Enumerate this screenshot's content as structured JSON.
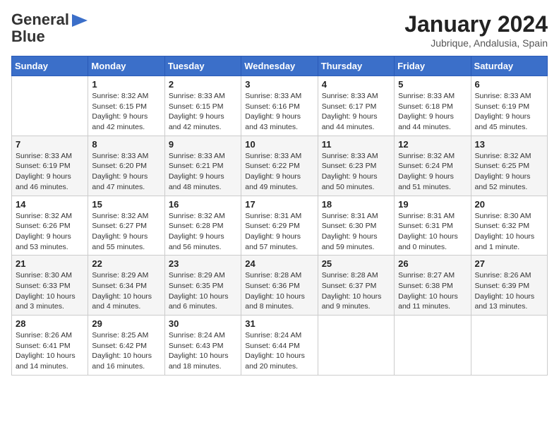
{
  "logo": {
    "general": "General",
    "blue": "Blue",
    "arrow_symbol": "▶"
  },
  "title": "January 2024",
  "location": "Jubrique, Andalusia, Spain",
  "headers": [
    "Sunday",
    "Monday",
    "Tuesday",
    "Wednesday",
    "Thursday",
    "Friday",
    "Saturday"
  ],
  "weeks": [
    [
      {
        "day": "",
        "info": ""
      },
      {
        "day": "1",
        "info": "Sunrise: 8:32 AM\nSunset: 6:15 PM\nDaylight: 9 hours\nand 42 minutes."
      },
      {
        "day": "2",
        "info": "Sunrise: 8:33 AM\nSunset: 6:15 PM\nDaylight: 9 hours\nand 42 minutes."
      },
      {
        "day": "3",
        "info": "Sunrise: 8:33 AM\nSunset: 6:16 PM\nDaylight: 9 hours\nand 43 minutes."
      },
      {
        "day": "4",
        "info": "Sunrise: 8:33 AM\nSunset: 6:17 PM\nDaylight: 9 hours\nand 44 minutes."
      },
      {
        "day": "5",
        "info": "Sunrise: 8:33 AM\nSunset: 6:18 PM\nDaylight: 9 hours\nand 44 minutes."
      },
      {
        "day": "6",
        "info": "Sunrise: 8:33 AM\nSunset: 6:19 PM\nDaylight: 9 hours\nand 45 minutes."
      }
    ],
    [
      {
        "day": "7",
        "info": "Sunrise: 8:33 AM\nSunset: 6:19 PM\nDaylight: 9 hours\nand 46 minutes."
      },
      {
        "day": "8",
        "info": "Sunrise: 8:33 AM\nSunset: 6:20 PM\nDaylight: 9 hours\nand 47 minutes."
      },
      {
        "day": "9",
        "info": "Sunrise: 8:33 AM\nSunset: 6:21 PM\nDaylight: 9 hours\nand 48 minutes."
      },
      {
        "day": "10",
        "info": "Sunrise: 8:33 AM\nSunset: 6:22 PM\nDaylight: 9 hours\nand 49 minutes."
      },
      {
        "day": "11",
        "info": "Sunrise: 8:33 AM\nSunset: 6:23 PM\nDaylight: 9 hours\nand 50 minutes."
      },
      {
        "day": "12",
        "info": "Sunrise: 8:32 AM\nSunset: 6:24 PM\nDaylight: 9 hours\nand 51 minutes."
      },
      {
        "day": "13",
        "info": "Sunrise: 8:32 AM\nSunset: 6:25 PM\nDaylight: 9 hours\nand 52 minutes."
      }
    ],
    [
      {
        "day": "14",
        "info": "Sunrise: 8:32 AM\nSunset: 6:26 PM\nDaylight: 9 hours\nand 53 minutes."
      },
      {
        "day": "15",
        "info": "Sunrise: 8:32 AM\nSunset: 6:27 PM\nDaylight: 9 hours\nand 55 minutes."
      },
      {
        "day": "16",
        "info": "Sunrise: 8:32 AM\nSunset: 6:28 PM\nDaylight: 9 hours\nand 56 minutes."
      },
      {
        "day": "17",
        "info": "Sunrise: 8:31 AM\nSunset: 6:29 PM\nDaylight: 9 hours\nand 57 minutes."
      },
      {
        "day": "18",
        "info": "Sunrise: 8:31 AM\nSunset: 6:30 PM\nDaylight: 9 hours\nand 59 minutes."
      },
      {
        "day": "19",
        "info": "Sunrise: 8:31 AM\nSunset: 6:31 PM\nDaylight: 10 hours\nand 0 minutes."
      },
      {
        "day": "20",
        "info": "Sunrise: 8:30 AM\nSunset: 6:32 PM\nDaylight: 10 hours\nand 1 minute."
      }
    ],
    [
      {
        "day": "21",
        "info": "Sunrise: 8:30 AM\nSunset: 6:33 PM\nDaylight: 10 hours\nand 3 minutes."
      },
      {
        "day": "22",
        "info": "Sunrise: 8:29 AM\nSunset: 6:34 PM\nDaylight: 10 hours\nand 4 minutes."
      },
      {
        "day": "23",
        "info": "Sunrise: 8:29 AM\nSunset: 6:35 PM\nDaylight: 10 hours\nand 6 minutes."
      },
      {
        "day": "24",
        "info": "Sunrise: 8:28 AM\nSunset: 6:36 PM\nDaylight: 10 hours\nand 8 minutes."
      },
      {
        "day": "25",
        "info": "Sunrise: 8:28 AM\nSunset: 6:37 PM\nDaylight: 10 hours\nand 9 minutes."
      },
      {
        "day": "26",
        "info": "Sunrise: 8:27 AM\nSunset: 6:38 PM\nDaylight: 10 hours\nand 11 minutes."
      },
      {
        "day": "27",
        "info": "Sunrise: 8:26 AM\nSunset: 6:39 PM\nDaylight: 10 hours\nand 13 minutes."
      }
    ],
    [
      {
        "day": "28",
        "info": "Sunrise: 8:26 AM\nSunset: 6:41 PM\nDaylight: 10 hours\nand 14 minutes."
      },
      {
        "day": "29",
        "info": "Sunrise: 8:25 AM\nSunset: 6:42 PM\nDaylight: 10 hours\nand 16 minutes."
      },
      {
        "day": "30",
        "info": "Sunrise: 8:24 AM\nSunset: 6:43 PM\nDaylight: 10 hours\nand 18 minutes."
      },
      {
        "day": "31",
        "info": "Sunrise: 8:24 AM\nSunset: 6:44 PM\nDaylight: 10 hours\nand 20 minutes."
      },
      {
        "day": "",
        "info": ""
      },
      {
        "day": "",
        "info": ""
      },
      {
        "day": "",
        "info": ""
      }
    ]
  ]
}
